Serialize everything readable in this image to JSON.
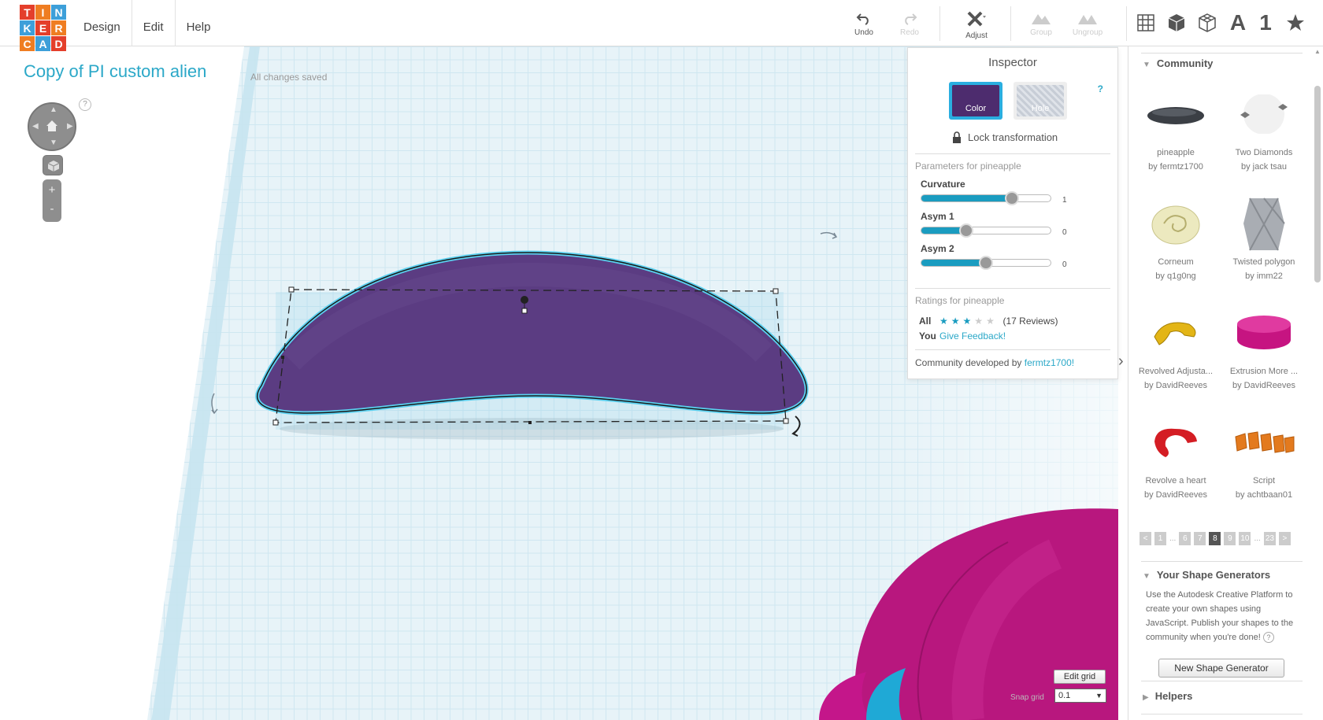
{
  "logo": {
    "letters": [
      "T",
      "I",
      "N",
      "K",
      "E",
      "R",
      "C",
      "A",
      "D"
    ],
    "colors": [
      "#e43f2b",
      "#ef7d22",
      "#3d9fd9",
      "#3d9fd9",
      "#e43f2b",
      "#ef7d22",
      "#ef7d22",
      "#3d9fd9",
      "#e43f2b"
    ]
  },
  "menu": {
    "design": "Design",
    "edit": "Edit",
    "help": "Help"
  },
  "toolbar": {
    "undo": "Undo",
    "redo": "Redo",
    "adjust": "Adjust",
    "group": "Group",
    "ungroup": "Ungroup"
  },
  "views": {
    "text_tool": "A",
    "number_tool": "1"
  },
  "design": {
    "title": "Copy of PI custom alien",
    "save_status": "All changes saved"
  },
  "nav": {
    "help": "?",
    "zoom_in": "+",
    "zoom_out": "-"
  },
  "inspector": {
    "title": "Inspector",
    "color_label": "Color",
    "hole_label": "Hole",
    "help": "?",
    "color_value": "#4d2c6e",
    "lock_label": "Lock transformation",
    "params_heading": "Parameters for pineapple",
    "params": [
      {
        "name": "Curvature",
        "value": "1",
        "fraction": 0.7
      },
      {
        "name": "Asym 1",
        "value": "0",
        "fraction": 0.35
      },
      {
        "name": "Asym 2",
        "value": "0",
        "fraction": 0.5
      }
    ],
    "ratings_heading": "Ratings for pineapple",
    "ratings_all_label": "All",
    "ratings_stars_filled": 3,
    "ratings_stars_total": 5,
    "ratings_reviews": "(17 Reviews)",
    "ratings_you_label": "You",
    "feedback_link": "Give Feedback!",
    "community_prefix": "Community developed by",
    "community_author": "fermtz1700!"
  },
  "community": {
    "header": "Community",
    "shapes": [
      {
        "name": "pineapple",
        "author": "by fermtz1700",
        "icon": "pineapple-shape-icon"
      },
      {
        "name": "Two Diamonds",
        "author": "by jack tsau",
        "icon": "two-diamonds-shape-icon"
      },
      {
        "name": "Corneum",
        "author": "by q1g0ng",
        "icon": "corneum-shape-icon"
      },
      {
        "name": "Twisted polygon",
        "author": "by imm22",
        "icon": "twisted-polygon-shape-icon"
      },
      {
        "name": "Revolved Adjusta...",
        "author": "by DavidReeves",
        "icon": "revolved-shape-icon"
      },
      {
        "name": "Extrusion More ...",
        "author": "by DavidReeves",
        "icon": "extrusion-shape-icon"
      },
      {
        "name": "Revolve a heart",
        "author": "by DavidReeves",
        "icon": "heart-shape-icon"
      },
      {
        "name": "Script",
        "author": "by achtbaan01",
        "icon": "script-shape-icon"
      }
    ],
    "pager": [
      "<",
      "1",
      "...",
      "6",
      "7",
      "8",
      "9",
      "10",
      "...",
      "23",
      ">"
    ],
    "active_page": "8"
  },
  "generators": {
    "header": "Your Shape Generators",
    "text": "Use the Autodesk Creative Platform to create your own shapes using JavaScript. Publish your shapes to the community when you're done!",
    "help": "?",
    "button": "New Shape Generator"
  },
  "helpers": {
    "header": "Helpers"
  },
  "grid": {
    "edit_label": "Edit grid",
    "snap_label": "Snap grid",
    "snap_value": "0.1"
  }
}
